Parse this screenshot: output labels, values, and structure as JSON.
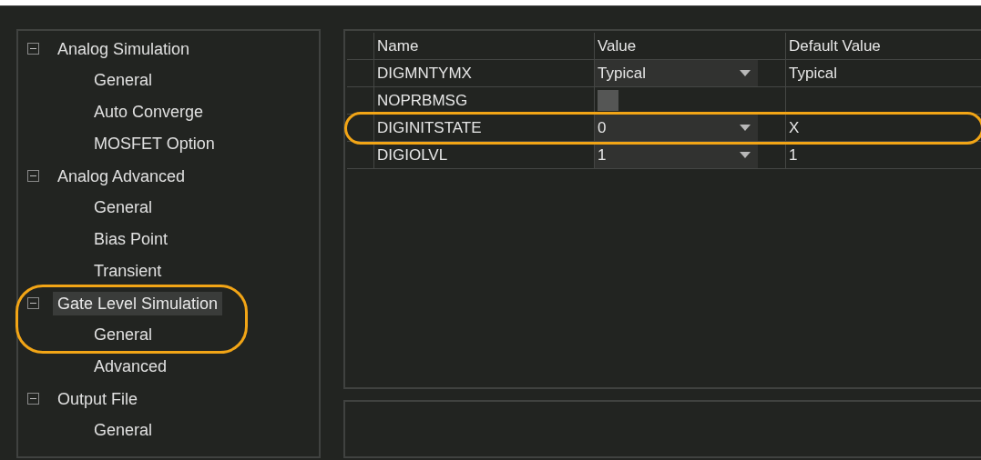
{
  "tree": [
    {
      "label": "Analog Simulation",
      "expanded": true,
      "selected": false,
      "annotated": false,
      "children": [
        {
          "label": "General"
        },
        {
          "label": "Auto Converge"
        },
        {
          "label": "MOSFET Option"
        }
      ]
    },
    {
      "label": "Analog Advanced",
      "expanded": true,
      "selected": false,
      "annotated": false,
      "children": [
        {
          "label": "General"
        },
        {
          "label": "Bias Point"
        },
        {
          "label": "Transient"
        }
      ]
    },
    {
      "label": "Gate Level Simulation",
      "expanded": true,
      "selected": true,
      "annotated": true,
      "children": [
        {
          "label": "General"
        },
        {
          "label": "Advanced"
        }
      ]
    },
    {
      "label": "Output File",
      "expanded": true,
      "selected": false,
      "annotated": false,
      "children": [
        {
          "label": "General"
        }
      ]
    }
  ],
  "table": {
    "columns": [
      "Name",
      "Value",
      "Default Value"
    ],
    "rows": [
      {
        "name": "DIGMNTYMX",
        "kind": "dropdown",
        "value": "Typical",
        "default": "Typical",
        "annotated": false
      },
      {
        "name": "NOPRBMSG",
        "kind": "checkbox",
        "checked": false,
        "annotated": false
      },
      {
        "name": "DIGINITSTATE",
        "kind": "dropdown",
        "value": "0",
        "default": "X",
        "annotated": true
      },
      {
        "name": "DIGIOLVL",
        "kind": "dropdown",
        "value": "1",
        "default": "1",
        "annotated": false
      }
    ]
  }
}
